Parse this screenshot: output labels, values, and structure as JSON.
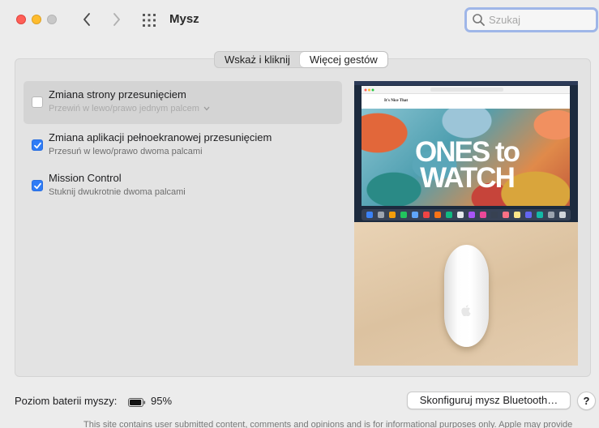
{
  "window": {
    "title": "Mysz"
  },
  "search": {
    "placeholder": "Szukaj"
  },
  "tabs": [
    {
      "label": "Wskaż i kliknij",
      "active": false
    },
    {
      "label": "Więcej gestów",
      "active": true
    }
  ],
  "gestures": [
    {
      "title": "Zmiana strony przesunięciem",
      "subtitle": "Przewiń w lewo/prawo jednym palcem",
      "checked": false,
      "selected": true
    },
    {
      "title": "Zmiana aplikacji pełnoekranowej przesunięciem",
      "subtitle": "Przesuń w lewo/prawo dwoma palcami",
      "checked": true,
      "selected": false
    },
    {
      "title": "Mission Control",
      "subtitle": "Stuknij dwukrotnie dwoma palcami",
      "checked": true,
      "selected": false
    }
  ],
  "preview": {
    "headline": "ONES to WATCH",
    "site_name": "It's Nice That"
  },
  "footer": {
    "battery_label": "Poziom baterii myszy:",
    "battery_value": "95%",
    "battery_level": 0.95,
    "bluetooth_button": "Skonfiguruj mysz Bluetooth…",
    "help_label": "?"
  },
  "background_text": "This site contains user submitted content, comments and opinions and is for informational purposes only. Apple may provide",
  "colors": {
    "accent": "#2f7cf6",
    "close": "#ff5f57",
    "minimize": "#febc2e",
    "maximize": "#c8c8c8"
  }
}
